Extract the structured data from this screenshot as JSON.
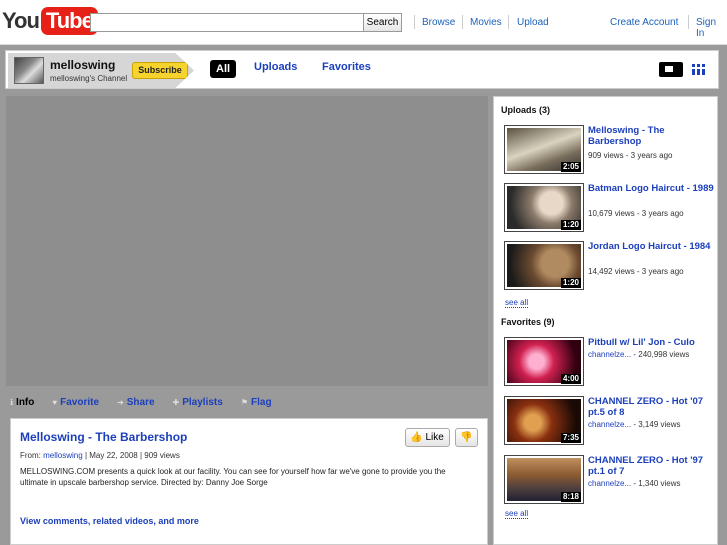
{
  "masthead": {
    "logo_you": "You",
    "logo_tube": "Tube",
    "search_value": "",
    "search_button": "Search",
    "nav": [
      "Browse",
      "Movies",
      "Upload"
    ],
    "create_account": "Create Account",
    "sign_in": "Sign In"
  },
  "channel": {
    "name": "melloswing",
    "subtitle": "melloswing's Channel",
    "subscribe": "Subscribe",
    "tabs": [
      "All",
      "Uploads",
      "Favorites"
    ]
  },
  "actions": [
    {
      "icon": "info-icon",
      "label": "Info"
    },
    {
      "icon": "heart-icon",
      "label": "Favorite"
    },
    {
      "icon": "share-arrow-icon",
      "label": "Share"
    },
    {
      "icon": "plus-icon",
      "label": "Playlists"
    },
    {
      "icon": "flag-icon",
      "label": "Flag"
    }
  ],
  "video": {
    "title": "Melloswing - The Barbershop",
    "like_label": "Like",
    "from_label": "From:",
    "from_user": "melloswing",
    "date": "| May 22, 2008",
    "views": "| 909 views",
    "description": "MELLOSWING.COM presents a quick look at our facility. You can see for yourself how far we've gone to provide you the ultimate in upscale barbershop service. Directed by: Danny Joe Sorge",
    "more_link": "View comments, related videos, and more"
  },
  "sidebar": {
    "uploads_heading": "Uploads (3)",
    "uploads": [
      {
        "title": "Melloswing - The Barbershop",
        "meta": "909 views - 3 years ago",
        "duration": "2:05"
      },
      {
        "title": "Batman Logo Haircut - 1989",
        "meta": "10,679 views - 3 years ago",
        "duration": "1:20"
      },
      {
        "title": "Jordan Logo Haircut - 1984",
        "meta": "14,492 views - 3 years ago",
        "duration": "1:20"
      }
    ],
    "uploads_see_all": "see all",
    "favorites_heading": "Favorites (9)",
    "favorites": [
      {
        "title": "Pitbull w/ Lil' Jon - Culo",
        "channel": "channelze...",
        "views": " - 240,998 views",
        "duration": "4:00"
      },
      {
        "title": "CHANNEL ZERO - Hot '07 pt.5 of 8",
        "channel": "channelze...",
        "views": " - 3,149 views",
        "duration": "7:35"
      },
      {
        "title": "CHANNEL ZERO - Hot '97 pt.1 of 7",
        "channel": "channelze...",
        "views": " - 1,340 views",
        "duration": "8:18"
      }
    ],
    "favorites_see_all": "see all"
  },
  "colors": {
    "link": "#1c3fbb",
    "accent_red": "#e62117",
    "subscribe_yellow": "#f6d32d",
    "background": "#9a9a9a"
  }
}
